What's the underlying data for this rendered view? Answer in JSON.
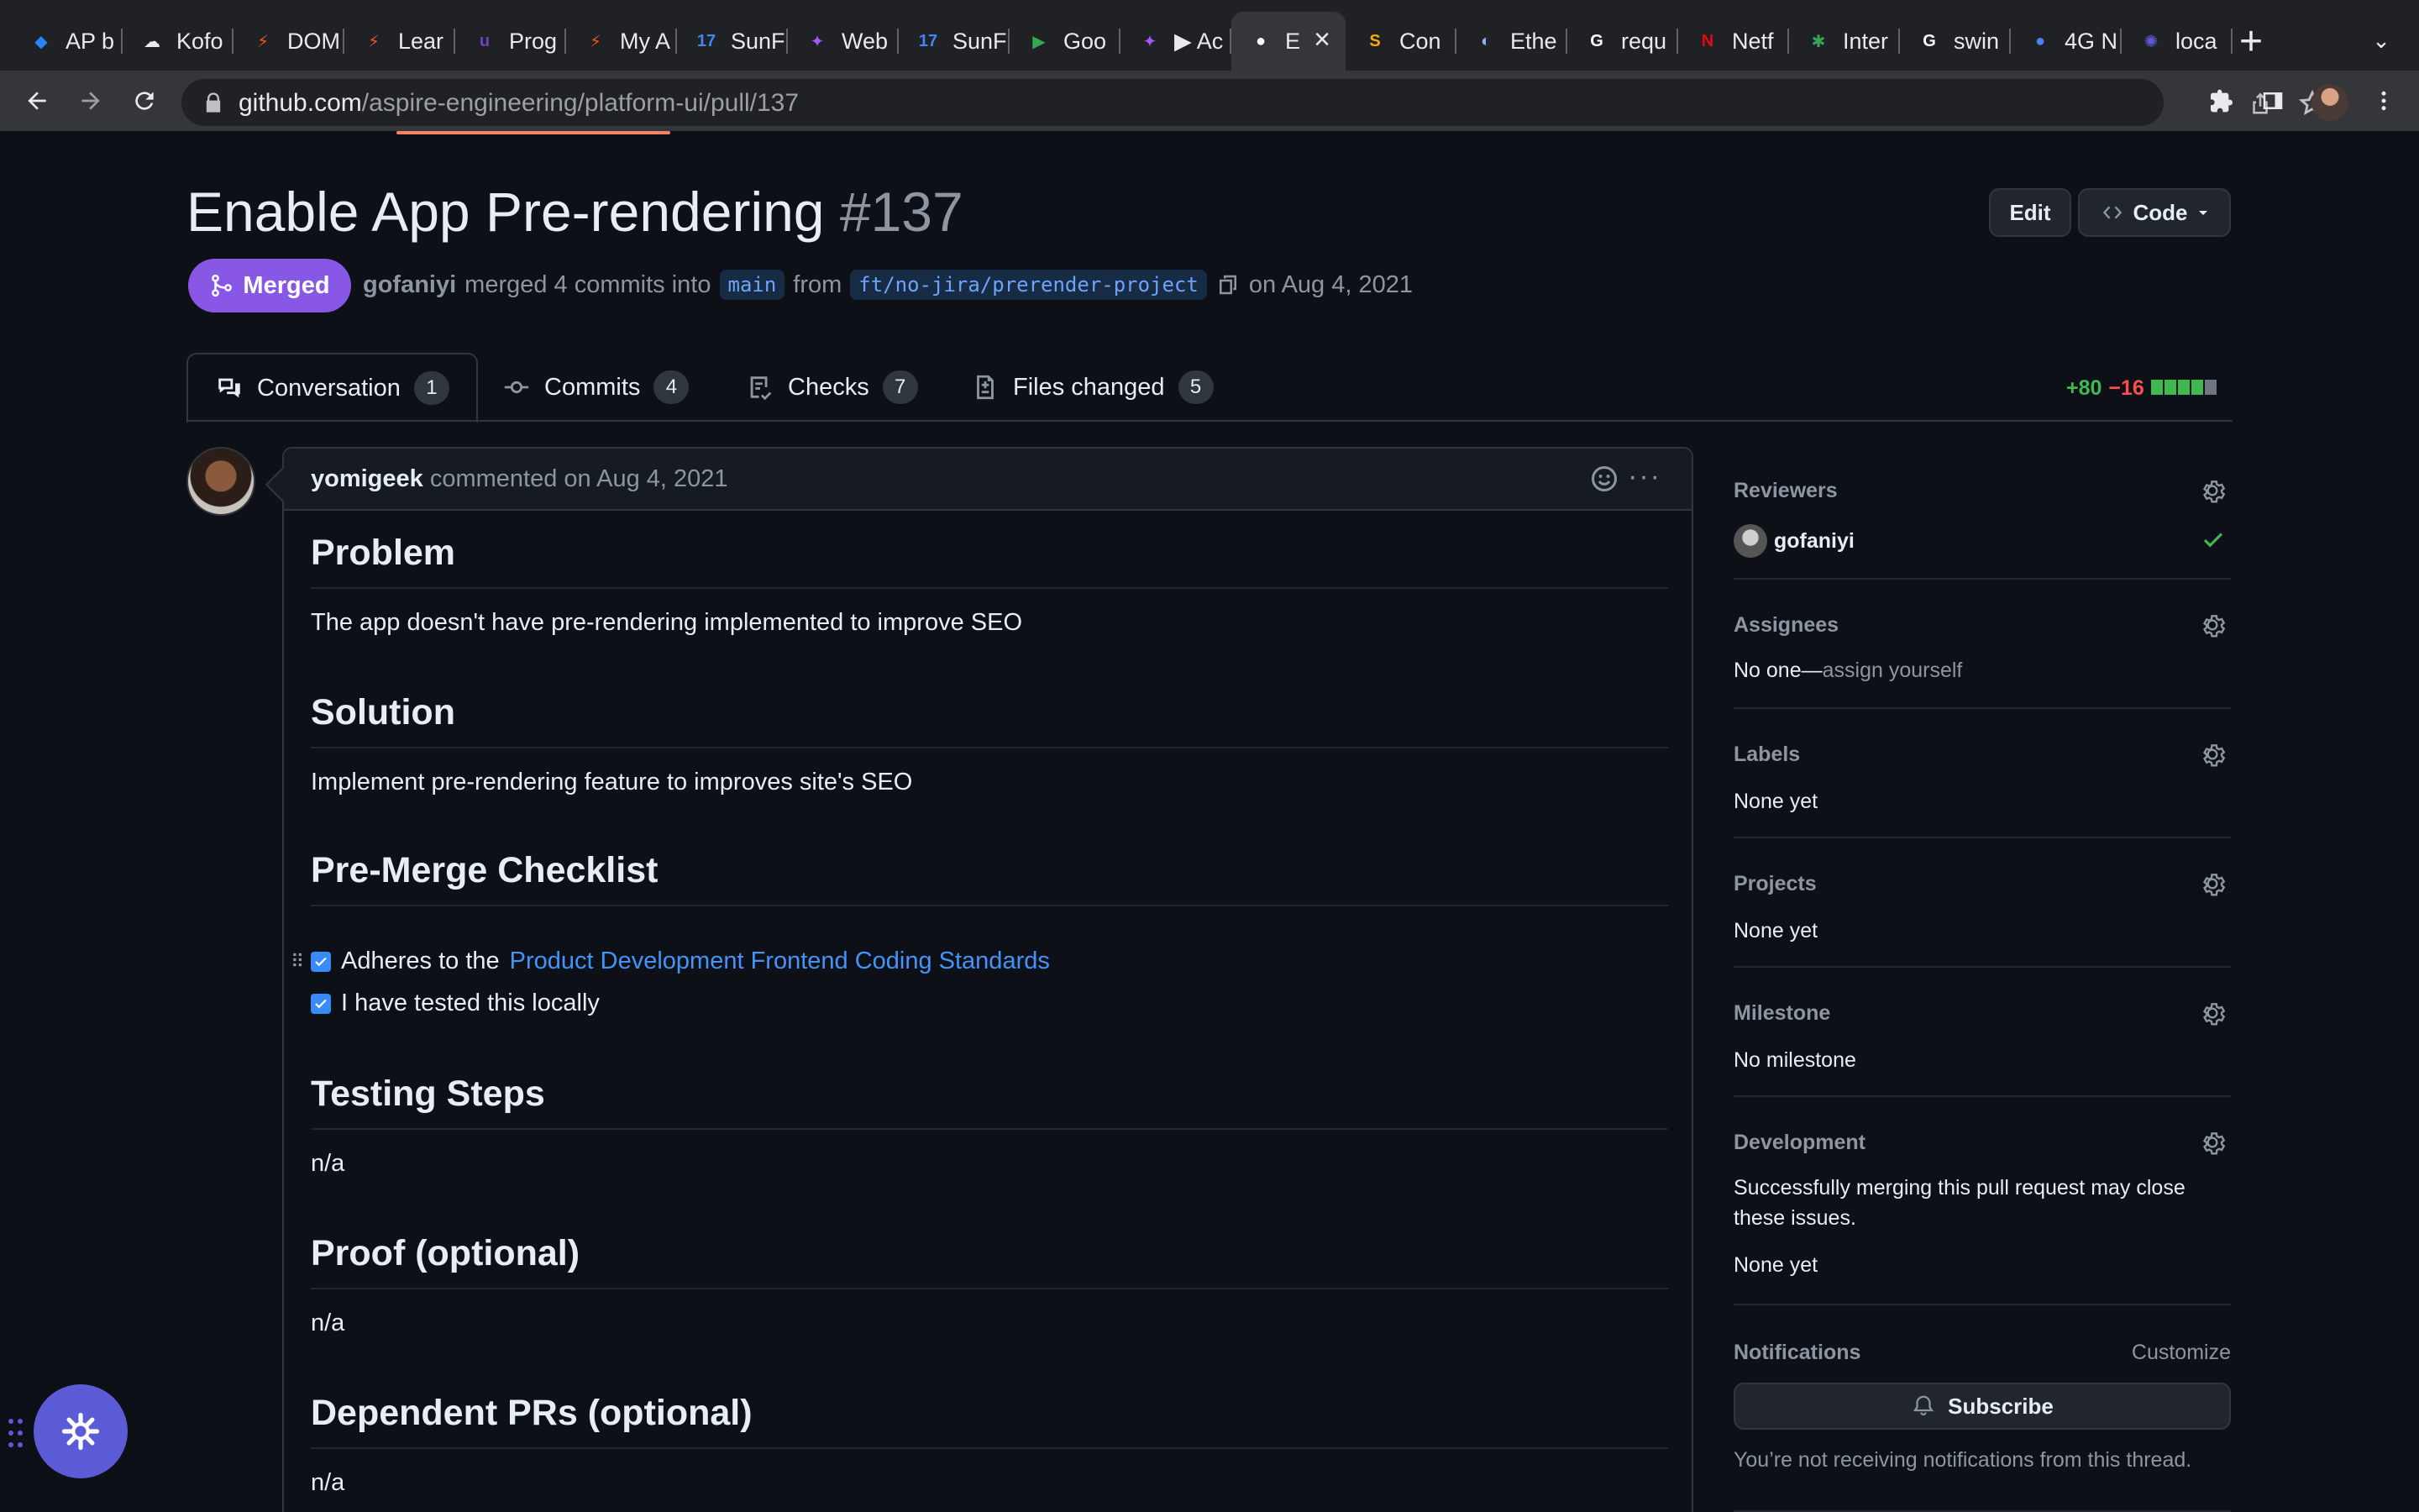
{
  "browser": {
    "tabs": [
      {
        "label": "AP b",
        "color": "#2684ff",
        "glyph": "◆"
      },
      {
        "label": "Kofo",
        "color": "#e8eaed",
        "glyph": "☁"
      },
      {
        "label": "DOM",
        "color": "#f4511e",
        "glyph": "⚡"
      },
      {
        "label": "Lear",
        "color": "#f4511e",
        "glyph": "⚡"
      },
      {
        "label": "Prog",
        "color": "#6f42c1",
        "glyph": "u"
      },
      {
        "label": "My A",
        "color": "#f4511e",
        "glyph": "⚡"
      },
      {
        "label": "SunF",
        "color": "#4285f4",
        "glyph": "17"
      },
      {
        "label": "Web",
        "color": "#a259ff",
        "glyph": "✦"
      },
      {
        "label": "SunF",
        "color": "#4285f4",
        "glyph": "17"
      },
      {
        "label": "Goo",
        "color": "#34a853",
        "glyph": "▶"
      },
      {
        "label": "▶ Ac",
        "color": "#a259ff",
        "glyph": "✦"
      },
      {
        "label": "E",
        "color": "#ffffff",
        "glyph": "●",
        "active": true
      },
      {
        "label": "Con",
        "color": "#f9ab00",
        "glyph": "S"
      },
      {
        "label": "Ethe",
        "color": "#8ab4f8",
        "glyph": "◐"
      },
      {
        "label": "requ",
        "color": "#ffffff",
        "glyph": "G"
      },
      {
        "label": "Netf",
        "color": "#e50914",
        "glyph": "N"
      },
      {
        "label": "Inter",
        "color": "#34a853",
        "glyph": "✱"
      },
      {
        "label": "swin",
        "color": "#ffffff",
        "glyph": "G"
      },
      {
        "label": "4G N",
        "color": "#4285f4",
        "glyph": "●"
      },
      {
        "label": "loca",
        "color": "#5b5bd6",
        "glyph": "✺"
      }
    ],
    "url_host": "github.com",
    "url_path": "/aspire-engineering/platform-ui/pull/137"
  },
  "pr": {
    "title": "Enable App Pre-rendering",
    "number": "#137",
    "edit_label": "Edit",
    "code_label": "Code",
    "status": "Merged",
    "author": "gofaniyi",
    "merge_text": "merged 4 commits into",
    "base_branch": "main",
    "from_text": "from",
    "head_branch": "ft/no-jira/prerender-project",
    "date_text": "on Aug 4, 2021"
  },
  "tabs": [
    {
      "label": "Conversation",
      "count": "1",
      "icon": "comment-discussion-icon"
    },
    {
      "label": "Commits",
      "count": "4",
      "icon": "git-commit-icon"
    },
    {
      "label": "Checks",
      "count": "7",
      "icon": "checklist-icon"
    },
    {
      "label": "Files changed",
      "count": "5",
      "icon": "file-diff-icon"
    }
  ],
  "diffstat": {
    "additions": "+80",
    "deletions": "−16",
    "blocks": [
      "green",
      "green",
      "green",
      "green",
      "gray"
    ]
  },
  "comment": {
    "author": "yomigeek",
    "meta": "commented on Aug 4, 2021",
    "sections": [
      {
        "heading": "Problem",
        "body": "The app doesn't have pre-rendering implemented to improve SEO"
      },
      {
        "heading": "Solution",
        "body": "Implement pre-rendering feature to improves site's SEO"
      },
      {
        "heading": "Pre-Merge Checklist",
        "body": ""
      },
      {
        "heading": "Testing Steps",
        "body": "n/a"
      },
      {
        "heading": "Proof (optional)",
        "body": "n/a"
      },
      {
        "heading": "Dependent PRs (optional)",
        "body": "n/a"
      }
    ],
    "checklist": [
      {
        "prefix": "Adheres to the",
        "link": "Product Development Frontend Coding Standards",
        "checked": true
      },
      {
        "prefix": "I have tested this locally",
        "link": "",
        "checked": true
      }
    ]
  },
  "sidebar": {
    "reviewers": {
      "title": "Reviewers",
      "name": "gofaniyi"
    },
    "assignees": {
      "title": "Assignees",
      "text": "No one—",
      "link": "assign yourself"
    },
    "labels": {
      "title": "Labels",
      "text": "None yet"
    },
    "projects": {
      "title": "Projects",
      "text": "None yet"
    },
    "milestone": {
      "title": "Milestone",
      "text": "No milestone"
    },
    "development": {
      "title": "Development",
      "line1": "Successfully merging this pull request may close",
      "line2": "these issues.",
      "text": "None yet"
    },
    "notifications": {
      "title": "Notifications",
      "customize": "Customize",
      "subscribe": "Subscribe",
      "note": "You’re not receiving notifications from this thread."
    }
  }
}
